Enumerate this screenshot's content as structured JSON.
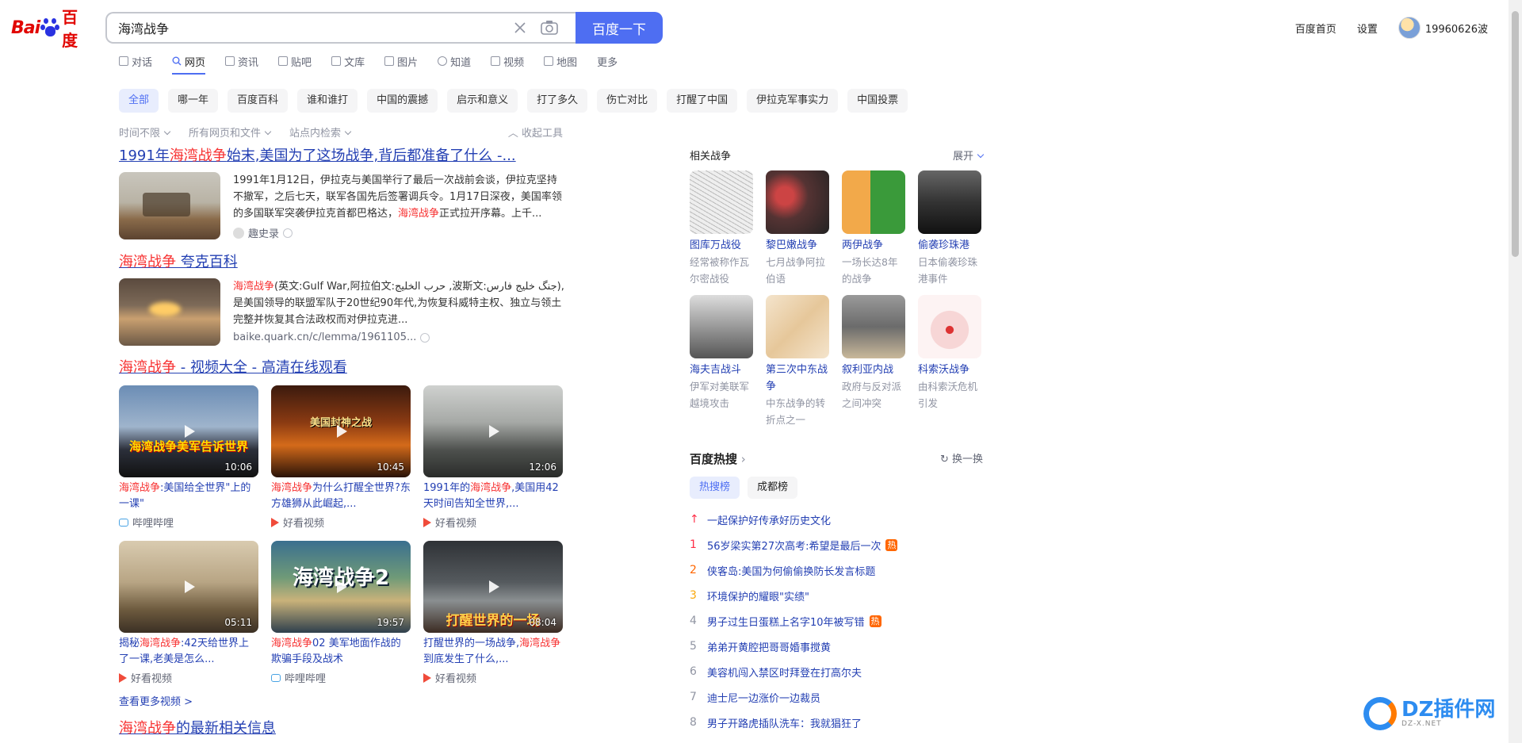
{
  "header": {
    "logo_bai": "Bai",
    "logo_cn": "百度",
    "search_value": "海湾战争",
    "search_button": "百度一下",
    "links": [
      "百度首页",
      "设置"
    ],
    "username": "19960626波"
  },
  "tabs": [
    {
      "label": "对话",
      "icon": "ai-icon"
    },
    {
      "label": "网页",
      "icon": "search-icon",
      "active": true
    },
    {
      "label": "资讯",
      "icon": "news-icon"
    },
    {
      "label": "贴吧",
      "icon": "tieba-icon"
    },
    {
      "label": "文库",
      "icon": "doc-icon"
    },
    {
      "label": "图片",
      "icon": "image-icon"
    },
    {
      "label": "知道",
      "icon": "question-icon"
    },
    {
      "label": "视频",
      "icon": "video-icon"
    },
    {
      "label": "地图",
      "icon": "map-icon"
    },
    {
      "label": "更多",
      "icon": ""
    }
  ],
  "chips": [
    "全部",
    "哪一年",
    "百度百科",
    "谁和谁打",
    "中国的震撼",
    "启示和意义",
    "打了多久",
    "伤亡对比",
    "打醒了中国",
    "伊拉克军事实力",
    "中国投票"
  ],
  "tools": {
    "time": "时间不限",
    "files": "所有网页和文件",
    "site": "站点内检索",
    "collapse": "收起工具"
  },
  "results": {
    "r1": {
      "title_pre": "1991年",
      "title_hl": "海湾战争",
      "title_post": "始末,美国为了这场战争,背后都准备了什么 -...",
      "snippet_pre": "1991年1月12日，伊拉克与美国举行了最后一次战前会谈，伊拉克坚持不撤军，之后七天，联军各国先后签署调兵令。1月17日深夜，美国率领的多国联军突袭伊拉克首都巴格达，",
      "snippet_hl": "海湾战争",
      "snippet_post": "正式拉开序幕。上千...",
      "source": "趣史录"
    },
    "r2": {
      "title_hl": "海湾战争",
      "title_post": " 夸克百科",
      "snippet_hl": "海湾战争",
      "snippet_post": "(英文:Gulf War,阿拉伯文:حرب الخليج ,波斯文:جنگ خلیج فارس),是美国领导的联盟军队于20世纪90年代,为恢复科威特主权、独立与领土完整并恢复其合法政权而对伊拉克进...",
      "source": "baike.quark.cn/c/lemma/1961105..."
    },
    "videos": {
      "title_hl": "海湾战争",
      "title_post": " - 视频大全 - 高清在线观看",
      "more": "查看更多视频 >",
      "items": [
        {
          "caption": "海湾战争美军告诉世界",
          "duration": "10:06",
          "title_hl": "海湾战争",
          "title_post": ":美国给全世界\"上的一课\"",
          "source": "哔哩哔哩"
        },
        {
          "caption": "美国封神之战",
          "duration": "10:45",
          "title_hl": "海湾战争",
          "title_post": "为什么打醒全世界?东方雄狮从此崛起,...",
          "source": "好看视频"
        },
        {
          "caption": "",
          "duration": "12:06",
          "title_pre": "1991年的",
          "title_hl": "海湾战争",
          "title_post": ",美国用42天时间告知全世界,...",
          "source": "好看视频"
        },
        {
          "caption": "",
          "duration": "05:11",
          "title_pre": "揭秘",
          "title_hl": "海湾战争",
          "title_post": ":42天给世界上了一课,老美是怎么...",
          "source": "好看视频"
        },
        {
          "caption": "海湾战争2",
          "duration": "19:57",
          "title_hl": "海湾战争",
          "title_post": "02 美军地面作战的欺骗手段及战术",
          "source": "哔哩哔哩"
        },
        {
          "caption": "打醒世界的一场",
          "duration": "08:04",
          "title_pre": "打醒世界的一场战争,",
          "title_hl": "海湾战争",
          "title_post": "到底发生了什么,...",
          "source": "好看视频"
        }
      ]
    },
    "r4": {
      "title_hl": "海湾战争",
      "title_post": "的最新相关信息"
    }
  },
  "related": {
    "heading": "相关战争",
    "expand": "展开",
    "items": [
      {
        "name": "图库万战役",
        "desc": "经常被称作瓦尔密战役"
      },
      {
        "name": "黎巴嫩战争",
        "desc": "七月战争阿拉伯语"
      },
      {
        "name": "两伊战争",
        "desc": "一场长达8年的战争"
      },
      {
        "name": "偷袭珍珠港",
        "desc": "日本偷袭珍珠港事件"
      },
      {
        "name": "海夫吉战斗",
        "desc": "伊军对美联军越境攻击"
      },
      {
        "name": "第三次中东战争",
        "desc": "中东战争的转折点之一"
      },
      {
        "name": "叙利亚内战",
        "desc": "政府与反对派之间冲突"
      },
      {
        "name": "科索沃战争",
        "desc": "由科索沃危机引发"
      }
    ]
  },
  "hot": {
    "heading": "百度热搜",
    "refresh": "换一换",
    "tabs": [
      "热搜榜",
      "成都榜"
    ],
    "items": [
      {
        "rank": "↑",
        "text": "一起保护好传承好历史文化",
        "tag": ""
      },
      {
        "rank": "1",
        "text": "56岁梁实第27次高考:希望是最后一次",
        "tag": "热"
      },
      {
        "rank": "2",
        "text": "侠客岛:美国为何偷偷换防长发言标题",
        "tag": ""
      },
      {
        "rank": "3",
        "text": "环境保护的耀眼\"实绩\"",
        "tag": ""
      },
      {
        "rank": "4",
        "text": "男子过生日蛋糕上名字10年被写错",
        "tag": "热"
      },
      {
        "rank": "5",
        "text": "弟弟开黄腔把哥哥婚事搅黄",
        "tag": ""
      },
      {
        "rank": "6",
        "text": "美容机闯入禁区时拜登在打高尔夫",
        "tag": ""
      },
      {
        "rank": "7",
        "text": "迪士尼一边涨价一边裁员",
        "tag": ""
      },
      {
        "rank": "8",
        "text": "男子开路虎插队洗车：我就猖狂了",
        "tag": ""
      }
    ]
  },
  "watermark": {
    "title": "DZ插件网",
    "sub": "DZ-X.NET"
  }
}
